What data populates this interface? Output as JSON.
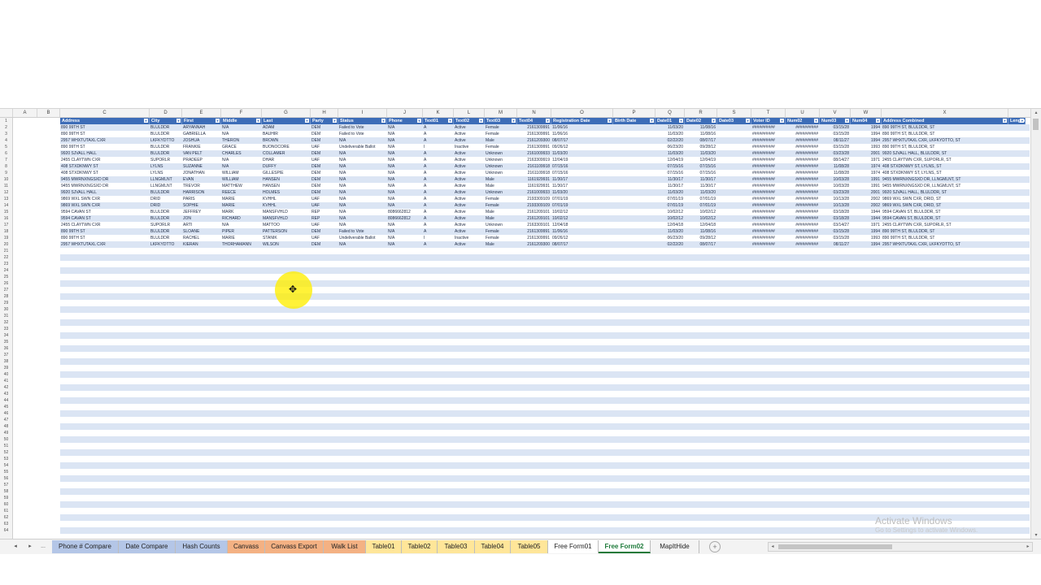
{
  "columns": [
    "A",
    "B",
    "C",
    "D",
    "E",
    "F",
    "G",
    "H",
    "I",
    "J",
    "K",
    "L",
    "M",
    "N",
    "O",
    "P",
    "Q",
    "R",
    "S",
    "T",
    "U",
    "V",
    "W",
    "X"
  ],
  "table_headers": [
    "Address",
    "City",
    "First",
    "Middle",
    "Last",
    "Party",
    "Status",
    "Phone",
    "Text01",
    "Text02",
    "Text03",
    "Text04",
    "Registration Date",
    "Birth Date",
    "Date01",
    "Date02",
    "Date03",
    "Voter ID",
    "Num02",
    "Num03",
    "Num04",
    "Address Combined",
    "Length"
  ],
  "rows": [
    [
      "890 99TH ST",
      "BLULDDR",
      "ARYANNAH",
      "N/A",
      "ADAM",
      "DEM",
      "Failed to Vote",
      "N/A",
      "A",
      "Active",
      "Female",
      "2161309991",
      "11/06/16",
      "",
      "11/03/20",
      "11/08/16",
      "",
      "##########",
      "##########",
      "03/15/28",
      "1994",
      "890 99TH ST, BLULDDR, ST"
    ],
    [
      "890 99TH ST",
      "BLULDDR",
      "GABRIELLA",
      "N/A",
      "BAUHIR",
      "DEM",
      "Failed to Vote",
      "N/A",
      "A",
      "Active",
      "Female",
      "2161309991",
      "11/06/16",
      "",
      "11/03/20",
      "11/08/16",
      "",
      "##########",
      "##########",
      "03/15/28",
      "1994",
      "890 99TH ST, BLULDDR, ST"
    ],
    [
      "2957 WHXTUTAXL CXR",
      "LKFKYDTTO",
      "JOSHUA",
      "THERON",
      "BROWN",
      "DEM",
      "N/A",
      "N/A",
      "A",
      "Active",
      "Male",
      "2161209300",
      "08/07/17",
      "",
      "02/22/20",
      "08/07/17",
      "",
      "##########",
      "##########",
      "08/11/27",
      "1994",
      "2957 WHXTUTAXL CXR, LKFKYDTTO, ST"
    ],
    [
      "890 99TH ST",
      "BLULDDR",
      "FRANKIE",
      "GRACE",
      "BUONOCORE",
      "UAF",
      "Undeliverable Ballot",
      "N/A",
      "I",
      "Inactive",
      "Female",
      "2161309991",
      "09/26/12",
      "",
      "06/23/20",
      "09/28/12",
      "",
      "##########",
      "##########",
      "03/15/28",
      "1993",
      "890 99TH ST, BLULDDR, ST"
    ],
    [
      "9920 SJVALL HALL",
      "BLULDDR",
      "VAN PELT",
      "CHARLES",
      "COLLAMER",
      "DEM",
      "N/A",
      "N/A",
      "A",
      "Active",
      "Unknown",
      "2161009933",
      "11/03/20",
      "",
      "11/03/20",
      "11/03/20",
      "",
      "##########",
      "##########",
      "03/23/28",
      "2001",
      "9920 SJVALL HALL, BLULDDR, ST"
    ],
    [
      "2455 CLAYTWN CXR",
      "SUPORLR",
      "PRADEEP",
      "N/A",
      "DHAR",
      "UAF",
      "N/A",
      "N/A",
      "A",
      "Active",
      "Unknown",
      "2163309919",
      "12/04/19",
      "",
      "12/04/19",
      "12/04/19",
      "",
      "##########",
      "##########",
      "08/14/27",
      "1971",
      "2455 CLAYTWN CXR, SUPORLR, ST"
    ],
    [
      "408 STXDKNWY ST",
      "LYLNS",
      "SUZANNE",
      "N/A",
      "DUFFY",
      "DEM",
      "N/A",
      "N/A",
      "A",
      "Active",
      "Unknown",
      "2161109918",
      "07/15/16",
      "",
      "07/15/16",
      "07/15/16",
      "",
      "##########",
      "##########",
      "11/08/28",
      "1974",
      "408 STXDKNWY ST, LYLNS, ST"
    ],
    [
      "408 STXDKNWY ST",
      "LYLNS",
      "JONATHAN",
      "WILLIAM",
      "GILLESPIE",
      "DEM",
      "N/A",
      "N/A",
      "A",
      "Active",
      "Unknown",
      "2161109918",
      "07/15/16",
      "",
      "07/15/16",
      "07/15/16",
      "",
      "##########",
      "##########",
      "11/08/28",
      "1974",
      "408 STXDKNWY ST, LYLNS, ST"
    ],
    [
      "9455 MWRNXNGSXD DR",
      "LLNGMLNT",
      "EVAN",
      "WILLIAM",
      "HANSEN",
      "DEM",
      "N/A",
      "N/A",
      "A",
      "Active",
      "Male",
      "1161929931",
      "11/30/17",
      "",
      "11/30/17",
      "11/30/17",
      "",
      "##########",
      "##########",
      "10/03/28",
      "1991",
      "9455 MWRNXNGSXD DR, LLNGMLNT, ST"
    ],
    [
      "9455 MWRNXNGSXD DR",
      "LLNGMLNT",
      "TREVOR",
      "MATTHEW",
      "HANSEN",
      "DEM",
      "N/A",
      "N/A",
      "A",
      "Active",
      "Male",
      "1161929931",
      "11/30/17",
      "",
      "11/30/17",
      "11/30/17",
      "",
      "##########",
      "##########",
      "10/03/28",
      "1991",
      "9455 MWRNXNGSXD DR, LLNGMLNT, ST"
    ],
    [
      "9920 SJVALL HALL",
      "BLULDDR",
      "HARRISON",
      "REECE",
      "HOLMES",
      "DEM",
      "N/A",
      "N/A",
      "A",
      "Active",
      "Unknown",
      "2161009933",
      "11/03/20",
      "",
      "11/03/20",
      "11/03/20",
      "",
      "##########",
      "##########",
      "03/23/28",
      "2001",
      "9920 SJVALL HALL, BLULDDR, ST"
    ],
    [
      "9869 WXL SWN CXR",
      "DRID",
      "PARIS",
      "MARIE",
      "KVHHL",
      "UAF",
      "N/A",
      "N/A",
      "A",
      "Active",
      "Female",
      "2193309109",
      "07/01/19",
      "",
      "07/01/19",
      "07/01/19",
      "",
      "##########",
      "##########",
      "10/13/28",
      "2002",
      "9869 WXL SWN CXR, DRID, ST"
    ],
    [
      "9869 WXL SWN CXR",
      "DRID",
      "SOPHIE",
      "MARIE",
      "KVHHL",
      "UAF",
      "N/A",
      "N/A",
      "A",
      "Active",
      "Female",
      "2193309109",
      "07/01/19",
      "",
      "07/01/19",
      "07/01/19",
      "",
      "##########",
      "##########",
      "10/13/28",
      "2002",
      "9869 WXL SWN CXR, DRID, ST"
    ],
    [
      "9594 CAVAN ST",
      "BLULDDR",
      "JEFFREY",
      "MARK",
      "MANSFVHLD",
      "REP",
      "N/A",
      "8086662812",
      "A",
      "Active",
      "Male",
      "2161209101",
      "10/02/12",
      "",
      "10/02/12",
      "10/02/12",
      "",
      "##########",
      "##########",
      "03/18/28",
      "1944",
      "9594 CAVAN ST, BLULDDR, ST"
    ],
    [
      "9594 CAVAN ST",
      "BLULDDR",
      "JON",
      "RICHARD",
      "MANSFVHLD",
      "REP",
      "N/A",
      "8086662812",
      "A",
      "Active",
      "Male",
      "2161209101",
      "10/02/12",
      "",
      "10/02/12",
      "10/02/12",
      "",
      "##########",
      "##########",
      "03/18/28",
      "1944",
      "9594 CAVAN ST, BLULDDR, ST"
    ],
    [
      "2455 CLAYTWN CXR",
      "SUPORLR",
      "ARTI",
      "N/A",
      "MATTOO",
      "UAF",
      "N/A",
      "N/A",
      "A",
      "Active",
      "Unknown",
      "2163309101",
      "12/04/18",
      "",
      "12/04/18",
      "12/04/18",
      "",
      "##########",
      "##########",
      "03/14/27",
      "1971",
      "2455 CLAYTWN CXR, SUPORLR, ST"
    ],
    [
      "890 99TH ST",
      "BLULDDR",
      "SLOANE",
      "PIPER",
      "PATTERSON",
      "DEM",
      "Failed to Vote",
      "N/A",
      "A",
      "Active",
      "Female",
      "2161309991",
      "11/06/16",
      "",
      "11/03/20",
      "11/08/16",
      "",
      "##########",
      "##########",
      "03/15/28",
      "1994",
      "890 99TH ST, BLULDDR, ST"
    ],
    [
      "890 99TH ST",
      "BLULDDR",
      "RACHEL",
      "MARIE",
      "STANIK",
      "UAF",
      "Undeliverable Ballot",
      "N/A",
      "I",
      "Inactive",
      "Female",
      "2161309991",
      "09/26/12",
      "",
      "06/23/20",
      "09/28/12",
      "",
      "##########",
      "##########",
      "03/15/28",
      "1993",
      "890 99TH ST, BLULDDR, ST"
    ],
    [
      "2957 WHXTUTAXL CXR",
      "LKFKYDTTO",
      "KIERAN",
      "THORHAMANN",
      "WILSON",
      "DEM",
      "N/A",
      "N/A",
      "A",
      "Active",
      "Male",
      "2161209300",
      "08/07/17",
      "",
      "02/22/20",
      "08/07/17",
      "",
      "##########",
      "##########",
      "08/11/27",
      "1994",
      "2957 WHXTUTAXL CXR, LKFKYDTTO, ST"
    ]
  ],
  "tabs": [
    {
      "label": "Phone # Compare",
      "color": "#b4c6e7"
    },
    {
      "label": "Date Compare",
      "color": "#b4c6e7"
    },
    {
      "label": "Hash Counts",
      "color": "#b4c6e7"
    },
    {
      "label": "Canvass",
      "color": "#f4b183"
    },
    {
      "label": "Canvass Export",
      "color": "#f4b183"
    },
    {
      "label": "Walk List",
      "color": "#f4b183"
    },
    {
      "label": "Table01",
      "color": "#ffe699"
    },
    {
      "label": "Table02",
      "color": "#ffe699"
    },
    {
      "label": "Table03",
      "color": "#ffe699"
    },
    {
      "label": "Table04",
      "color": "#ffe699"
    },
    {
      "label": "Table05",
      "color": "#ffe699"
    },
    {
      "label": "Free Form01",
      "color": "#ffffff"
    },
    {
      "label": "Free Form02",
      "color": "#ffffff",
      "active": true
    },
    {
      "label": "MapItHide",
      "color": "#f3f3f3"
    }
  ],
  "tab_nav": {
    "prev": "◂",
    "next": "▸",
    "more": "..."
  },
  "add_sheet_label": "+",
  "watermark": {
    "line1": "Activate Windows",
    "line2": "Go to Settings to activate Windows."
  },
  "icons": {
    "cursor": "move-crosshair-icon",
    "add_sheet": "plus-circle-icon"
  }
}
